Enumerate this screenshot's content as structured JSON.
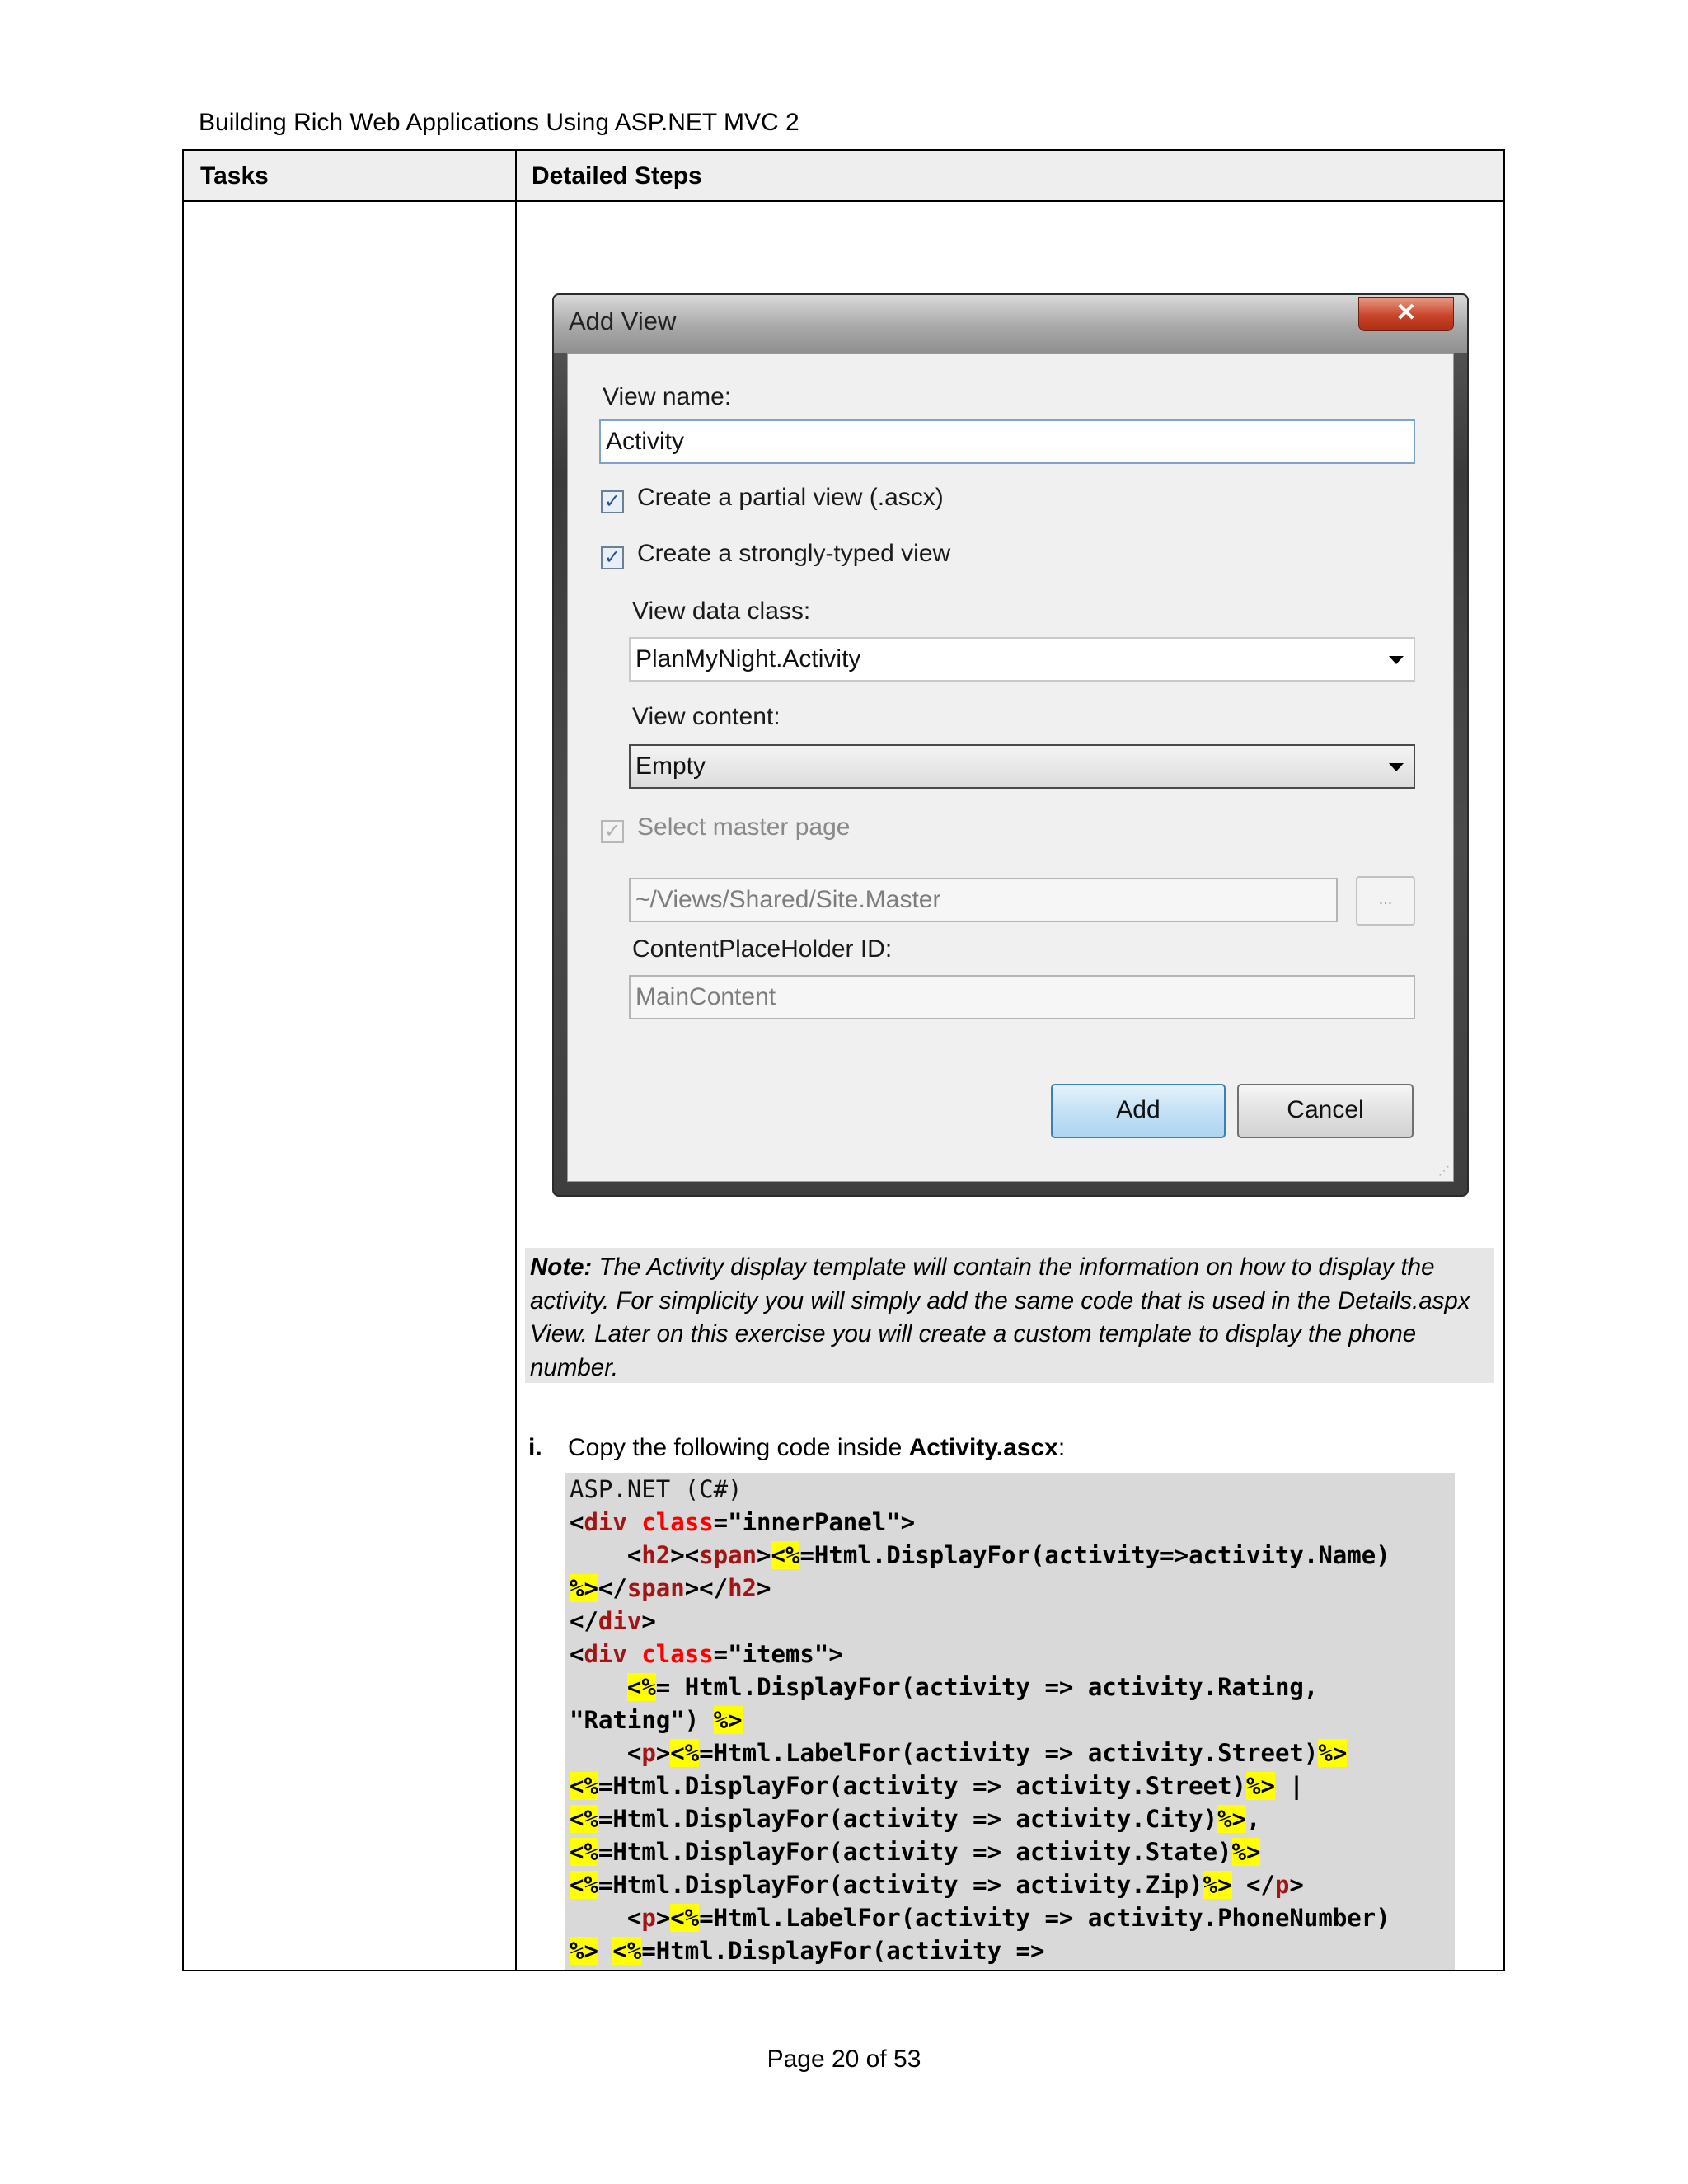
{
  "header": {
    "title": "Building Rich Web Applications Using ASP.NET MVC 2"
  },
  "table": {
    "col_tasks": "Tasks",
    "col_steps": "Detailed Steps"
  },
  "dialog": {
    "title": "Add View",
    "close_glyph": "✕",
    "view_name_label": "View name:",
    "view_name_value": "Activity",
    "partial_view_label": "Create a partial view (.ascx)",
    "partial_view_checked": true,
    "strongly_typed_label": "Create a strongly-typed view",
    "strongly_typed_checked": true,
    "data_class_label": "View data class:",
    "data_class_value": "PlanMyNight.Activity",
    "view_content_label": "View content:",
    "view_content_value": "Empty",
    "master_page_label": "Select master page",
    "master_page_checked": true,
    "master_page_path": "~/Views/Shared/Site.Master",
    "browse_label": "...",
    "placeholder_label": "ContentPlaceHolder ID:",
    "placeholder_value": "MainContent",
    "add_button": "Add",
    "cancel_button": "Cancel"
  },
  "note": {
    "lead": "Note:",
    "text": " The Activity display template will contain the information on how to display the activity. For simplicity you will simply add the same code that is used in the Details.aspx View. Later on this exercise you will create a custom template to display the phone number."
  },
  "step": {
    "number": "i.",
    "text_before": "Copy the following code inside ",
    "file": "Activity.ascx",
    "text_after": ":"
  },
  "code": {
    "language": "ASP.NET (C#)",
    "lines": [
      "<div class=\"innerPanel\">",
      "    <h2><span><%=Html.DisplayFor(activity=>activity.Name)",
      "%></span></h2>",
      "</div>",
      "<div class=\"items\">",
      "    <%= Html.DisplayFor(activity => activity.Rating,",
      "\"Rating\") %>",
      "    <p><%=Html.LabelFor(activity => activity.Street)%>",
      "<%=Html.DisplayFor(activity => activity.Street)%> |",
      "<%=Html.DisplayFor(activity => activity.City)%>,",
      "<%=Html.DisplayFor(activity => activity.State)%>",
      "<%=Html.DisplayFor(activity => activity.Zip)%> </p>",
      "    <p><%=Html.LabelFor(activity => activity.PhoneNumber)",
      "%> <%=Html.DisplayFor(activity =>"
    ]
  },
  "footer": {
    "page": "Page 20 of 53"
  }
}
